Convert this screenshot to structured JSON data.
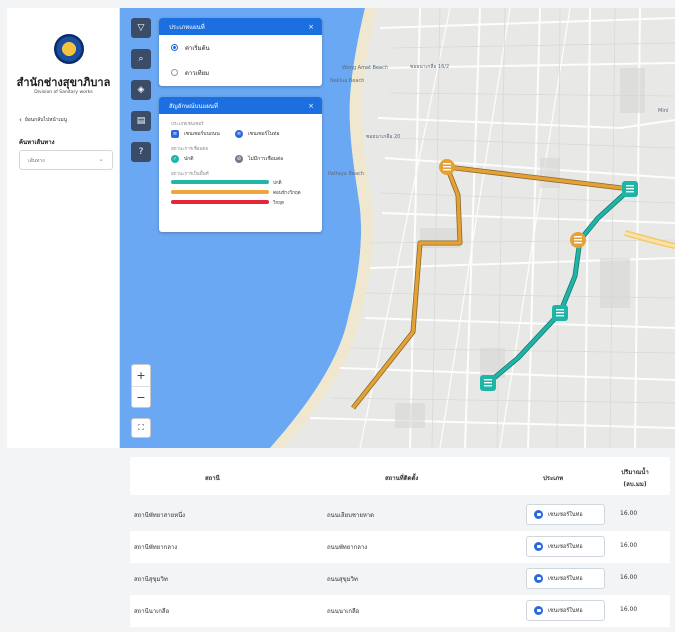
{
  "sidebar": {
    "org_title": "สำนักช่างสุขาภิบาล",
    "org_subtitle": "Division of Sanitary works",
    "back_label": "ย้อนกลับไปหน้าเมนู",
    "search_label": "ค้นหาเส้นทาง",
    "route_placeholder": "เส้นทาง"
  },
  "map": {
    "labels": [
      "Wong Amat Beach",
      "Naklua Beach",
      "ซอยนาเกลือ 16/2",
      "ซอยนาเกลือ 20",
      "Pattaya Beach",
      "Mini"
    ],
    "colors": {
      "water": "#6aa8f3",
      "route_orange": "#e5a135",
      "route_teal": "#1fb5a6"
    }
  },
  "panel_basemap": {
    "title": "ประเภทแผนที่",
    "options": [
      {
        "label": "ค่าเริ่มต้น",
        "selected": true
      },
      {
        "label": "ดาวเทียม",
        "selected": false
      }
    ]
  },
  "panel_legend": {
    "title": "สัญลักษณ์บนแผนที่",
    "sensor_caption": "ประเภทเซนเซอร์",
    "sensor_types": [
      "เซนเซอร์บนถนน",
      "เซนเซอร์ในท่อ"
    ],
    "connection_caption": "สถานะการเชื่อมต่อ",
    "connection_states": [
      "ปกติ",
      "ไม่มีการเชื่อมต่อ"
    ],
    "area_caption": "สถานะการเป็นพื้นที่",
    "area_states": [
      {
        "label": "ปกติ",
        "color": "#21b8a8"
      },
      {
        "label": "ค่อนข้างวิกฤต",
        "color": "#eda63a"
      },
      {
        "label": "วิกฤต",
        "color": "#e5253b"
      }
    ]
  },
  "table": {
    "headers": [
      "สถานี",
      "สถานที่ติดตั้ง",
      "ประเภท",
      "ปริมาณน้ำ",
      "(ลบ.มม)"
    ],
    "rows": [
      {
        "station": "สถานีพัทยาสายหนึ่ง",
        "location": "ถนนเลียบชายหาด",
        "type": "เซนเซอร์ในท่อ",
        "volume": "16.00"
      },
      {
        "station": "สถานีพัทยากลาง",
        "location": "ถนนพัทยากลาง",
        "type": "เซนเซอร์ในท่อ",
        "volume": "16.00"
      },
      {
        "station": "สถานีสุขุมวิท",
        "location": "ถนนสุขุมวิท",
        "type": "เซนเซอร์ในท่อ",
        "volume": "16.00"
      },
      {
        "station": "สถานีนาเกลือ",
        "location": "ถนนนาเกลือ",
        "type": "เซนเซอร์ในท่อ",
        "volume": "16.00"
      }
    ]
  }
}
